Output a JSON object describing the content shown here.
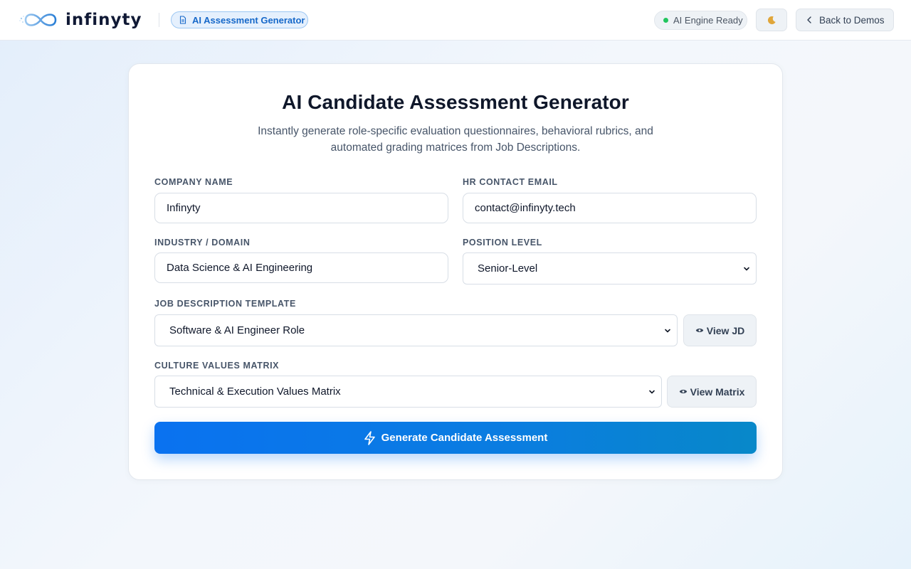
{
  "header": {
    "logo_text": "infinyty",
    "app_badge": "AI Assessment Generator",
    "status": "AI Engine Ready",
    "theme_toggle_icon": "moon-icon",
    "back_label": "Back to Demos"
  },
  "main": {
    "title": "AI Candidate Assessment Generator",
    "subtitle": "Instantly generate role-specific evaluation questionnaires, behavioral rubrics, and automated grading matrices from Job Descriptions.",
    "fields": {
      "company_name": {
        "label": "COMPANY NAME",
        "value": "Infinyty"
      },
      "hr_email": {
        "label": "HR CONTACT EMAIL",
        "value": "contact@infinyty.tech"
      },
      "industry": {
        "label": "INDUSTRY / DOMAIN",
        "value": "Data Science & AI Engineering"
      },
      "position_level": {
        "label": "POSITION LEVEL",
        "value": "Senior-Level"
      },
      "jd_template": {
        "label": "JOB DESCRIPTION TEMPLATE",
        "value": "Software & AI Engineer Role",
        "button": "View JD"
      },
      "culture_matrix": {
        "label": "CULTURE VALUES MATRIX",
        "value": "Technical & Execution Values Matrix",
        "button": "View Matrix"
      }
    },
    "generate_label": "Generate Candidate Assessment"
  },
  "colors": {
    "accent": "#0a72f0",
    "status_ok": "#22c55e",
    "badge_text": "#1668c9"
  }
}
